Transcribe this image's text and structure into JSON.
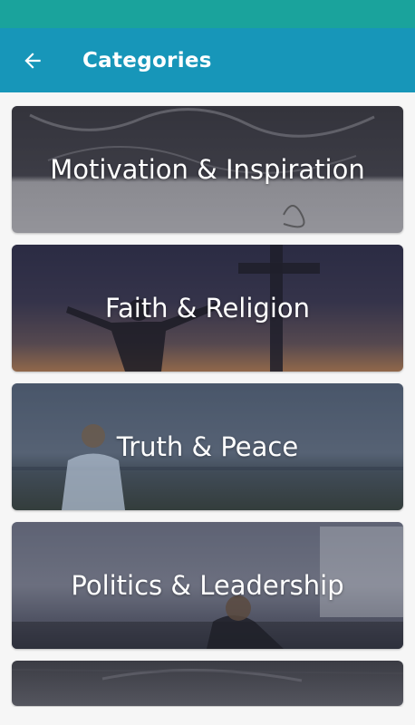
{
  "app_bar": {
    "title": "Categories",
    "back_icon": "arrow-left-icon"
  },
  "categories": [
    {
      "label": "Motivation & Inspiration"
    },
    {
      "label": "Faith & Religion"
    },
    {
      "label": "Truth & Peace"
    },
    {
      "label": "Politics & Leadership"
    },
    {
      "label": ""
    }
  ],
  "colors": {
    "status_bar": "#1aa39c",
    "app_bar": "#1796b9",
    "background": "#f6f6f6"
  }
}
